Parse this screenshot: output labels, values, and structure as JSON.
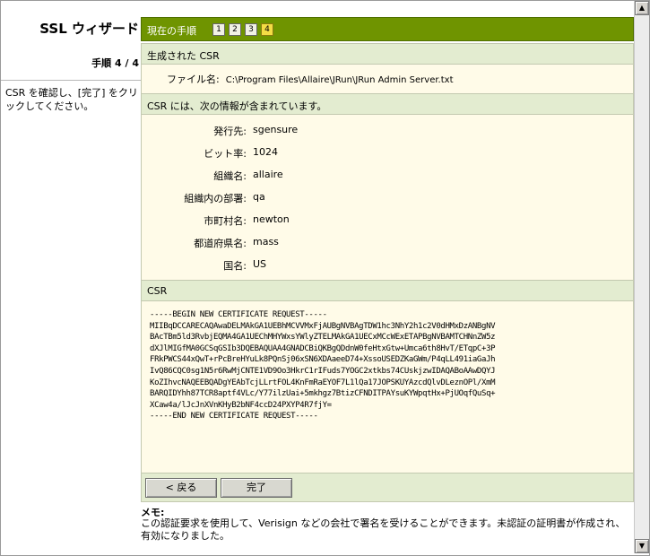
{
  "sidebar": {
    "wizard_title": "SSL ウィザード",
    "step_info": "手順 4 / 4",
    "help_text": "CSR を確認し、[完了] をクリックしてください。"
  },
  "header": {
    "label": "現在の手順",
    "steps": [
      "1",
      "2",
      "3",
      "4"
    ],
    "current_step": "4"
  },
  "generated_csr": {
    "title": "生成された CSR",
    "file_label": "ファイル名:",
    "file_value": "C:\\Program Files\\Allaire\\JRun\\JRun Admin Server.txt"
  },
  "csr_info": {
    "title": "CSR には、次の情報が含まれています。",
    "fields": [
      {
        "label": "発行先:",
        "value": "sgensure"
      },
      {
        "label": "ビット率:",
        "value": "1024"
      },
      {
        "label": "組織名:",
        "value": "allaire"
      },
      {
        "label": "組織内の部署:",
        "value": "qa"
      },
      {
        "label": "市町村名:",
        "value": "newton"
      },
      {
        "label": "都道府県名:",
        "value": "mass"
      },
      {
        "label": "国名:",
        "value": "US"
      }
    ]
  },
  "csr_block": {
    "title": "CSR",
    "text": "-----BEGIN NEW CERTIFICATE REQUEST-----\nMIIBqDCCARECAQAwaDELMAkGA1UEBhMCVVMxFjAUBgNVBAgTDW1hc3NhY2h1c2V0dHMxDzANBgNV\nBAcTBm5ld3RvbjEQMA4GA1UEChMHYWxsYWlyZTELMAkGA1UECxMCcWExETAPBgNVBAMTCHNnZW5z\ndXJlMIGfMA0GCSqGSIb3DQEBAQUAA4GNADCBiQKBgQDdnW0feHtxGtw+Umca6th8HvT/ETqpC+3P\nFRkPWCS44xQwT+rPcBreHYuLk8PQnSj06xSN6XDAaeeD74+XssoUSEDZKaGWm/P4qLL491iaGaJh\nIvQ86CQC0sg1N5r6RwMjCNTE1VD9Oo3HkrC1rIFuds7YOGC2xtkbs74CUskjzwIDAQABoAAwDQYJ\nKoZIhvcNAQEEBQADgYEAbTcjLLrtFOL4KnFmRaEYOF7L1lQa17JOPSKUYAzcdQlvDLeznOPl/XmM\nBARQIDYhh87TCR8aptf4VLc/Y77ilzUai+5mkhgz7BtizCFNDITPAYsuKYWpqtHx+PjUOqfQuSq+\nXCaw4a/lJcJnXVnKHyB2bNF4ccD24PXYP4R7fjY=\n-----END NEW CERTIFICATE REQUEST-----"
  },
  "buttons": {
    "back_label": "< 戻る",
    "finish_label": "完了"
  },
  "memo": {
    "title": "メモ:",
    "text": "この認証要求を使用して、Verisign などの会社で署名を受けることができます。未認証の証明書が作成され、有効になりました。"
  },
  "icons": {
    "scroll_up": "up-arrow-icon",
    "scroll_down": "down-arrow-icon"
  },
  "colors": {
    "header_green": "#6f9400",
    "section_bg": "#e3ecd0",
    "panel_bg": "#fffbe8",
    "current_step": "#f4dc45"
  }
}
